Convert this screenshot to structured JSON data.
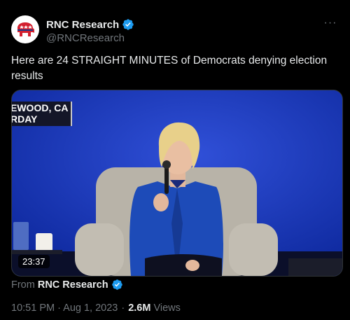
{
  "author": {
    "display_name": "RNC Research",
    "handle": "@RNCResearch"
  },
  "more_label": "···",
  "tweet": {
    "text": "Here are 24 STRAIGHT MINUTES of Democrats denying election results"
  },
  "media": {
    "location_line1": "EWOOD, CA",
    "location_line2": "RDAY",
    "duration": "23:37"
  },
  "source": {
    "from_label": "From",
    "name": "RNC Research"
  },
  "meta": {
    "timestamp": "10:51 PM · Aug 1, 2023",
    "separator": "·",
    "views_count": "2.6M",
    "views_label": "Views"
  },
  "colors": {
    "background": "#000000",
    "text": "#e7e9ea",
    "secondary": "#71767b",
    "verified": "#1d9bf0",
    "brand_red": "#d3202f"
  }
}
